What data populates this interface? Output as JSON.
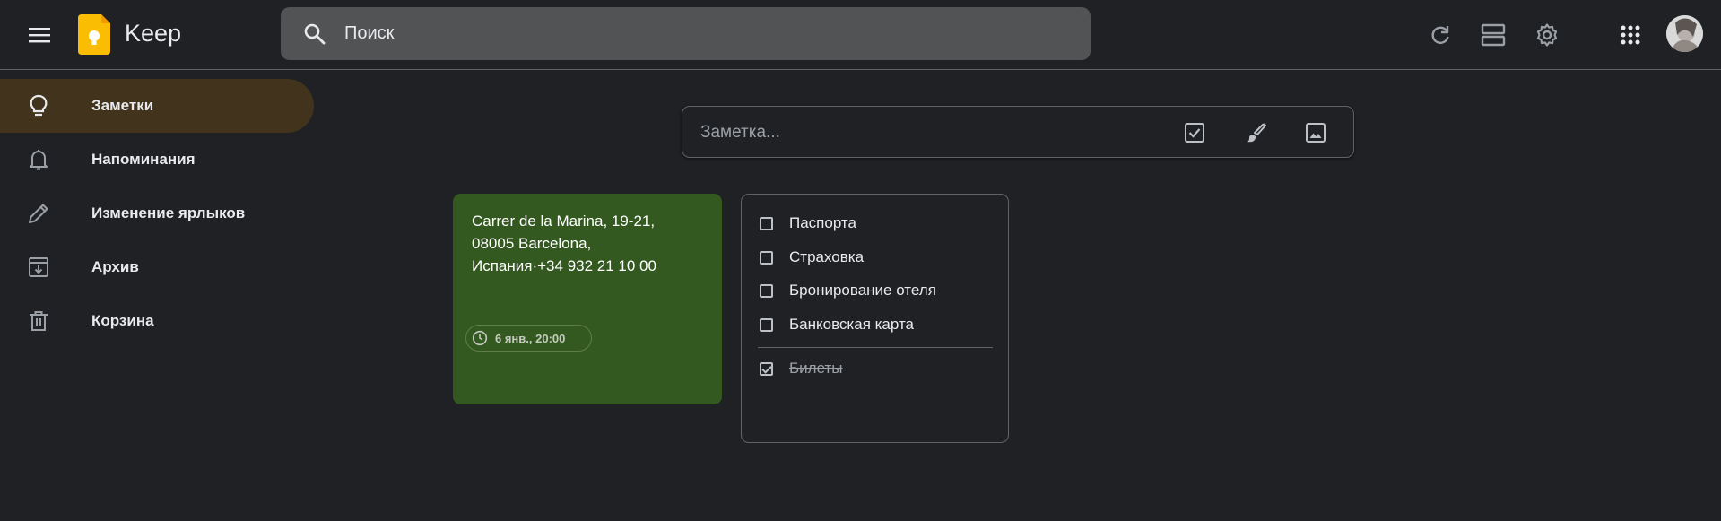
{
  "header": {
    "app_title": "Keep",
    "search_placeholder": "Поиск",
    "icons": [
      "menu-icon",
      "keep-logo-icon",
      "search-icon",
      "refresh-icon",
      "list-view-icon",
      "settings-icon",
      "apps-icon",
      "avatar"
    ]
  },
  "sidebar": {
    "items": [
      {
        "label": "Заметки",
        "icon": "lightbulb-icon",
        "active": true
      },
      {
        "label": "Напоминания",
        "icon": "bell-icon",
        "active": false
      },
      {
        "label": "Изменение ярлыков",
        "icon": "pencil-icon",
        "active": false
      },
      {
        "label": "Архив",
        "icon": "archive-icon",
        "active": false
      },
      {
        "label": "Корзина",
        "icon": "trash-icon",
        "active": false
      }
    ]
  },
  "note_bar": {
    "placeholder": "Заметка...",
    "actions": [
      "new-list-icon",
      "new-drawing-icon",
      "new-image-icon"
    ]
  },
  "notes": {
    "green_note": {
      "text": "Carrer de la Marina, 19-21,\n08005 Barcelona,\nИспания·+34 932 21 10 00",
      "reminder": "6 янв., 20:00",
      "color": "#345920"
    },
    "list_note": {
      "items": [
        {
          "text": "Паспорта",
          "checked": false
        },
        {
          "text": "Страховка",
          "checked": false
        },
        {
          "text": "Бронирование отеля",
          "checked": false
        },
        {
          "text": "Банковская карта",
          "checked": false
        },
        {
          "text": "Билеты",
          "checked": true
        }
      ]
    }
  },
  "colors": {
    "background": "#202124",
    "active_nav": "#41331c",
    "green_note": "#345920",
    "search_bg": "#525355",
    "logo_yellow": "#fbbc04"
  }
}
